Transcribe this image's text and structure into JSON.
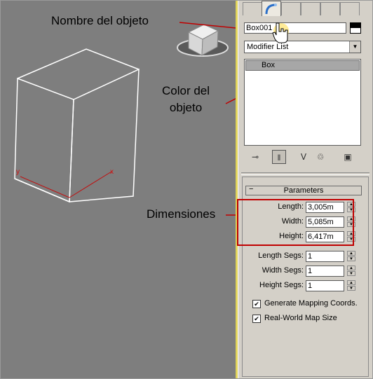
{
  "annotations": {
    "object_name": "Nombre del objeto",
    "object_color": "Color del\nobjeto",
    "dimensions": "Dimensiones"
  },
  "panel": {
    "object_name_value": "Box001",
    "object_color_hex": "#000000",
    "modifier_list_label": "Modifier List",
    "stack_items": [
      "Box"
    ],
    "rollout_title": "Parameters",
    "rollout_collapse_glyph": "−",
    "dimensions": [
      {
        "label": "Length:",
        "value": "3,005m"
      },
      {
        "label": "Width:",
        "value": "5,085m"
      },
      {
        "label": "Height:",
        "value": "6,417m"
      }
    ],
    "segments": [
      {
        "label": "Length Segs:",
        "value": "1"
      },
      {
        "label": "Width Segs:",
        "value": "1"
      },
      {
        "label": "Height Segs:",
        "value": "1"
      }
    ],
    "checkboxes": [
      {
        "label": "Generate Mapping Coords.",
        "checked": true
      },
      {
        "label": "Real-World Map Size",
        "checked": true
      }
    ]
  },
  "viewport": {
    "axis_labels": {
      "x": "x",
      "y": "y"
    },
    "background_hex": "#7e7e7e"
  },
  "colors": {
    "callout_arrow": "#c00000",
    "panel_bg": "#d4d0c8",
    "viewport_border": "#e0d35a"
  },
  "icons": [
    "modify-panel-icon",
    "view-cube-icon",
    "pin-stack-icon",
    "show-end-result-icon",
    "make-unique-icon",
    "remove-modifier-icon",
    "configure-modifier-sets-icon",
    "hand-cursor-icon"
  ]
}
